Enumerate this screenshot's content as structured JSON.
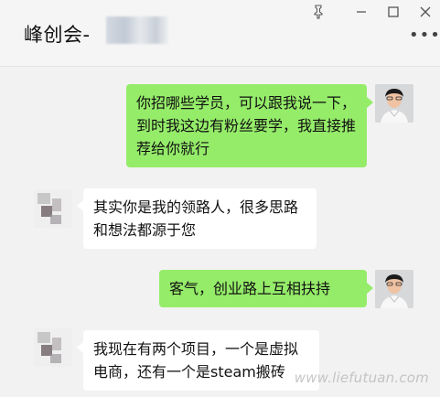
{
  "header": {
    "title": "峰创会-",
    "pin_icon": "pin-icon",
    "minimize_icon": "minimize-icon",
    "maximize_icon": "maximize-icon",
    "close_icon": "close-icon",
    "more_icon": "more-icon"
  },
  "messages": [
    {
      "side": "right",
      "text": "你招哪些学员，可以跟我说一下，到时我这边有粉丝要学，我直接推荐给你就行"
    },
    {
      "side": "left",
      "text": "其实你是我的领路人，很多思路和想法都源于您"
    },
    {
      "side": "right",
      "text": "客气，创业路上互相扶持"
    },
    {
      "side": "left",
      "text": "我现在有两个项目，一个是虚拟电商，还有一个是steam搬砖"
    }
  ],
  "watermark": "www.liefutuan.com",
  "colors": {
    "green_bubble": "#95ec69",
    "white_bubble": "#ffffff",
    "background": "#f2f2f2"
  }
}
